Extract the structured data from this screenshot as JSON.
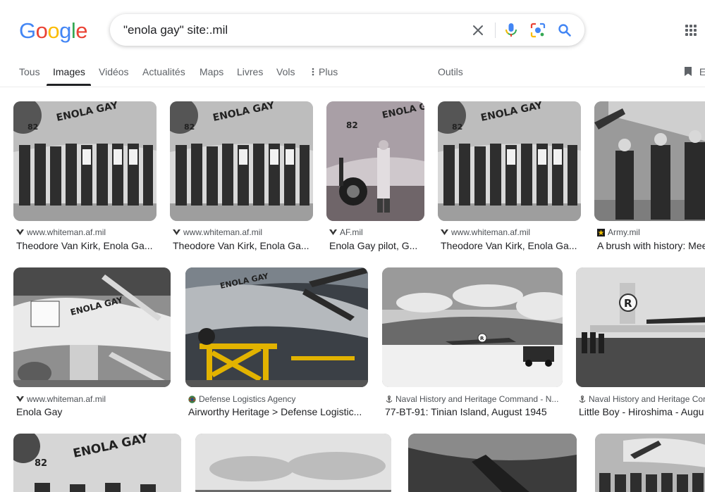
{
  "logo": {
    "letters": [
      "G",
      "o",
      "o",
      "g",
      "l",
      "e"
    ],
    "colors": [
      "#4285F4",
      "#EA4335",
      "#FBBC05",
      "#4285F4",
      "#34A853",
      "#EA4335"
    ]
  },
  "search": {
    "query": "\"enola gay\" site:.mil"
  },
  "icons": {
    "clear": "close-icon",
    "voice": "mic-icon",
    "lens": "lens-icon",
    "search": "search-icon",
    "apps": "apps-grid-icon",
    "saved": "bookmark-icon"
  },
  "tabs": {
    "items": [
      "Tous",
      "Images",
      "Vidéos",
      "Actualités",
      "Maps",
      "Livres",
      "Vols",
      "Plus"
    ],
    "active": "Images",
    "tools": "Outils",
    "saved_partial": "Er"
  },
  "results": [
    {
      "source": "www.whiteman.af.mil",
      "title": "Theodore Van Kirk, Enola Ga...",
      "favicon": "af-wings"
    },
    {
      "source": "www.whiteman.af.mil",
      "title": "Theodore Van Kirk, Enola Ga...",
      "favicon": "af-wings"
    },
    {
      "source": "AF.mil",
      "title": "Enola Gay pilot, G...",
      "favicon": "af-wings"
    },
    {
      "source": "www.whiteman.af.mil",
      "title": "Theodore Van Kirk, Enola Ga...",
      "favicon": "af-wings"
    },
    {
      "source": "Army.mil",
      "title": "A brush with history: Mee",
      "favicon": "army-star"
    },
    {
      "source": "www.whiteman.af.mil",
      "title": "Enola Gay",
      "favicon": "af-wings"
    },
    {
      "source": "Defense Logistics Agency",
      "title": "Airworthy Heritage > Defense Logistic...",
      "favicon": "dla-globe"
    },
    {
      "source": "Naval History and Heritage Command - N...",
      "title": "77-BT-91: Tinian Island, August 1945",
      "favicon": "anchor"
    },
    {
      "source": "Naval History and Heritage Con",
      "title": "Little Boy - Hiroshima - Augu",
      "favicon": "anchor"
    },
    {
      "source": "",
      "title": "",
      "favicon": ""
    },
    {
      "source": "",
      "title": "",
      "favicon": ""
    },
    {
      "source": "",
      "title": "",
      "favicon": ""
    },
    {
      "source": "",
      "title": "",
      "favicon": ""
    }
  ],
  "thumb_text": {
    "nose_art": "ENOLA GAY",
    "tail_letter": "R",
    "number": "82"
  }
}
